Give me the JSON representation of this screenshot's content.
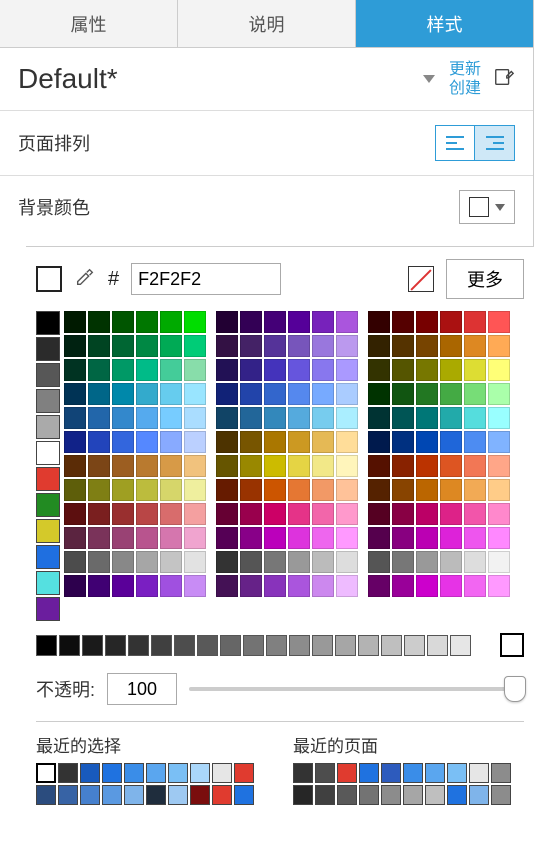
{
  "tabs": {
    "t0": "属性",
    "t1": "说明",
    "t2": "样式"
  },
  "style": {
    "name": "Default*",
    "update": "更新",
    "create": "创建"
  },
  "sections": {
    "page_arrange": "页面排列",
    "bg_color": "背景颜色"
  },
  "picker": {
    "hex": "F2F2F2",
    "more": "更多",
    "opacity_label": "不透明:",
    "opacity_value": "100",
    "recent_sel": "最近的选择",
    "recent_page": "最近的页面"
  },
  "side_colors": [
    "#000000",
    "#2b2b2b",
    "#575757",
    "#808080",
    "#aaaaaa",
    "#ffffff",
    "#e03b2f",
    "#228b22",
    "#d4c92a",
    "#1f6fe0",
    "#55e0e0",
    "#6b1e9e"
  ],
  "blocks": [
    [
      "#001a00",
      "#003300",
      "#005500",
      "#007700",
      "#00aa00",
      "#00dd00",
      "#002211",
      "#004422",
      "#006633",
      "#008844",
      "#00aa55",
      "#00cc77",
      "#003322",
      "#006644",
      "#009966",
      "#00bb88",
      "#44cc99",
      "#88ddaa",
      "#003355",
      "#006688",
      "#0088aa",
      "#33aacc",
      "#66ccee",
      "#99e5ff",
      "#114477",
      "#2266aa",
      "#3388cc",
      "#55aaee",
      "#77ccff",
      "#aaddff",
      "#112288",
      "#2244bb",
      "#3366dd",
      "#5588ff",
      "#88aaff",
      "#bbd0ff",
      "#5b2c06",
      "#7b4516",
      "#9c5e21",
      "#b97a2f",
      "#d79a47",
      "#f1c27d",
      "#5e5e0a",
      "#7f7f14",
      "#9f9f22",
      "#bcbc3d",
      "#d6d66a",
      "#efef9e",
      "#5c0f0f",
      "#7a1f1f",
      "#992f2f",
      "#b94646",
      "#d86c6c",
      "#f4a0a0",
      "#5b2440",
      "#7a335a",
      "#994274",
      "#b8548e",
      "#d576ae",
      "#f0a4cf",
      "#4c4c4c",
      "#6a6a6a",
      "#888888",
      "#a6a6a6",
      "#c4c4c4",
      "#e2e2e2",
      "#2d004d",
      "#400073",
      "#5a0099",
      "#7a1fc2",
      "#a050e0",
      "#c88cf5"
    ],
    [
      "#220033",
      "#330055",
      "#440077",
      "#550099",
      "#7722bb",
      "#aa55dd",
      "#331144",
      "#442266",
      "#553399",
      "#7755bb",
      "#9977dd",
      "#bb99ee",
      "#221155",
      "#332288",
      "#4433bb",
      "#6655dd",
      "#8877ee",
      "#aa99ff",
      "#112277",
      "#2244aa",
      "#3366cc",
      "#5588ee",
      "#77aaff",
      "#aaccff",
      "#114466",
      "#226699",
      "#3388bb",
      "#55aadd",
      "#77ccee",
      "#aaeeff",
      "#4d3300",
      "#775500",
      "#aa7700",
      "#cc9922",
      "#e5b955",
      "#ffdd99",
      "#665500",
      "#998800",
      "#ccbb00",
      "#e5d444",
      "#f2e888",
      "#fff5bb",
      "#661b00",
      "#993300",
      "#cc5500",
      "#e57733",
      "#f29966",
      "#ffc299",
      "#660033",
      "#99004d",
      "#cc0066",
      "#e53388",
      "#f266aa",
      "#ff99cc",
      "#550055",
      "#880088",
      "#bb00bb",
      "#dd33dd",
      "#ee66ee",
      "#ff99ff",
      "#333333",
      "#555555",
      "#777777",
      "#999999",
      "#bbbbbb",
      "#dddddd",
      "#441155",
      "#662288",
      "#8833bb",
      "#aa55dd",
      "#cc88ee",
      "#eebbff"
    ],
    [
      "#330000",
      "#550000",
      "#770000",
      "#aa1111",
      "#dd3333",
      "#ff5555",
      "#332200",
      "#553300",
      "#774400",
      "#aa6600",
      "#dd8822",
      "#ffaa55",
      "#333300",
      "#555500",
      "#777700",
      "#aaaa00",
      "#dddd33",
      "#ffff77",
      "#003300",
      "#115511",
      "#227722",
      "#44aa44",
      "#77dd77",
      "#aaffaa",
      "#003333",
      "#005555",
      "#007777",
      "#22aaaa",
      "#55dddd",
      "#99ffff",
      "#001a4d",
      "#003080",
      "#0047b3",
      "#1f66d9",
      "#4d8cf2",
      "#80b3ff",
      "#551100",
      "#882200",
      "#bb3300",
      "#dd5522",
      "#f27755",
      "#ffa688",
      "#552200",
      "#884400",
      "#bb6600",
      "#dd8822",
      "#f2aa55",
      "#ffcc88",
      "#550022",
      "#880044",
      "#bb0066",
      "#dd2288",
      "#f255aa",
      "#ff88cc",
      "#55004d",
      "#880080",
      "#bb00b3",
      "#dd22d9",
      "#ee55ee",
      "#ff88ff",
      "#555555",
      "#777777",
      "#999999",
      "#bbbbbb",
      "#dddddd",
      "#f2f2f2",
      "#660066",
      "#990099",
      "#cc00cc",
      "#e633e6",
      "#f266f2",
      "#ff99ff"
    ]
  ],
  "grays": [
    "#000000",
    "#0d0d0d",
    "#1a1a1a",
    "#262626",
    "#333333",
    "#404040",
    "#4d4d4d",
    "#595959",
    "#666666",
    "#737373",
    "#808080",
    "#8c8c8c",
    "#999999",
    "#a6a6a6",
    "#b3b3b3",
    "#bfbfbf",
    "#cccccc",
    "#d9d9d9",
    "#e6e6e6"
  ],
  "recent_sel_colors": [
    "#ffffff",
    "#333333",
    "#185abd",
    "#1f72e0",
    "#3a8de8",
    "#5aa6ef",
    "#7abff5",
    "#aad7fa",
    "#e6e6e6",
    "#e03b2f",
    "#2b4c7e",
    "#3763a5",
    "#4680cd",
    "#5a99e1",
    "#7fb4ea",
    "#1f2d3d",
    "#9ec9f2",
    "#7a0d0d",
    "#e03b2f",
    "#1f72e0"
  ],
  "recent_page_colors": [
    "#333333",
    "#4d4d4d",
    "#e03b2f",
    "#1f72e0",
    "#2d5bbd",
    "#3a8de8",
    "#5aa6ef",
    "#7abff5",
    "#e6e6e6",
    "#8c8c8c",
    "#262626",
    "#404040",
    "#595959",
    "#737373",
    "#8c8c8c",
    "#a6a6a6",
    "#bfbfbf",
    "#1f72e0",
    "#7fb4ea",
    "#8c8c8c"
  ]
}
